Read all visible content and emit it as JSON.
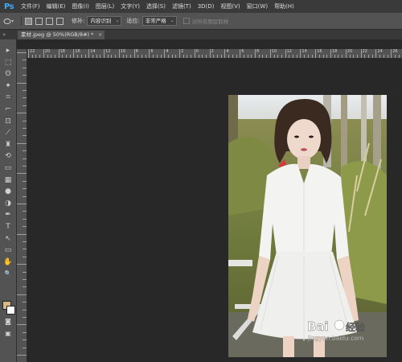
{
  "app": {
    "logo": "Ps"
  },
  "menu": [
    "文件(F)",
    "编辑(E)",
    "图像(I)",
    "图层(L)",
    "文字(Y)",
    "选择(S)",
    "滤镜(T)",
    "3D(D)",
    "视图(V)",
    "窗口(W)",
    "帮助(H)"
  ],
  "options": {
    "type_label": "修补:",
    "type_value": "内容识别",
    "adapt_label": "适应:",
    "adapt_value": "非常严格",
    "sample_all_label": "对所有图层取样"
  },
  "document": {
    "tab_title": "素材.jpeg @ 50%(RGB/8#) *",
    "close_glyph": "×"
  },
  "ruler": {
    "top_labels": [
      "22",
      "20",
      "18",
      "16",
      "14",
      "12",
      "10",
      "8",
      "6",
      "4",
      "2",
      "0",
      "2",
      "4",
      "6",
      "8",
      "10",
      "12",
      "14",
      "16",
      "18",
      "20",
      "22",
      "24",
      "26"
    ]
  },
  "colors": {
    "foreground": "#d8b98a",
    "background": "#ffffff",
    "ps_logo": "#3fa9f5"
  },
  "tools": [
    "move-icon",
    "marquee-icon",
    "lasso-icon",
    "magic-wand-icon",
    "crop-icon",
    "eyedropper-icon",
    "patch-icon",
    "brush-icon",
    "stamp-icon",
    "history-brush-icon",
    "eraser-icon",
    "gradient-icon",
    "blur-icon",
    "dodge-icon",
    "pen-icon",
    "type-icon",
    "path-select-icon",
    "shape-icon",
    "hand-icon",
    "zoom-icon"
  ],
  "tool_glyphs": [
    "▸",
    "⬚",
    "ʘ",
    "✦",
    "⌗",
    "⌐",
    "⊡",
    "⟋",
    "♜",
    "⟲",
    "▭",
    "▦",
    "●",
    "◑",
    "✒",
    "T",
    "↖",
    "▭",
    "✋",
    "🔍"
  ]
}
